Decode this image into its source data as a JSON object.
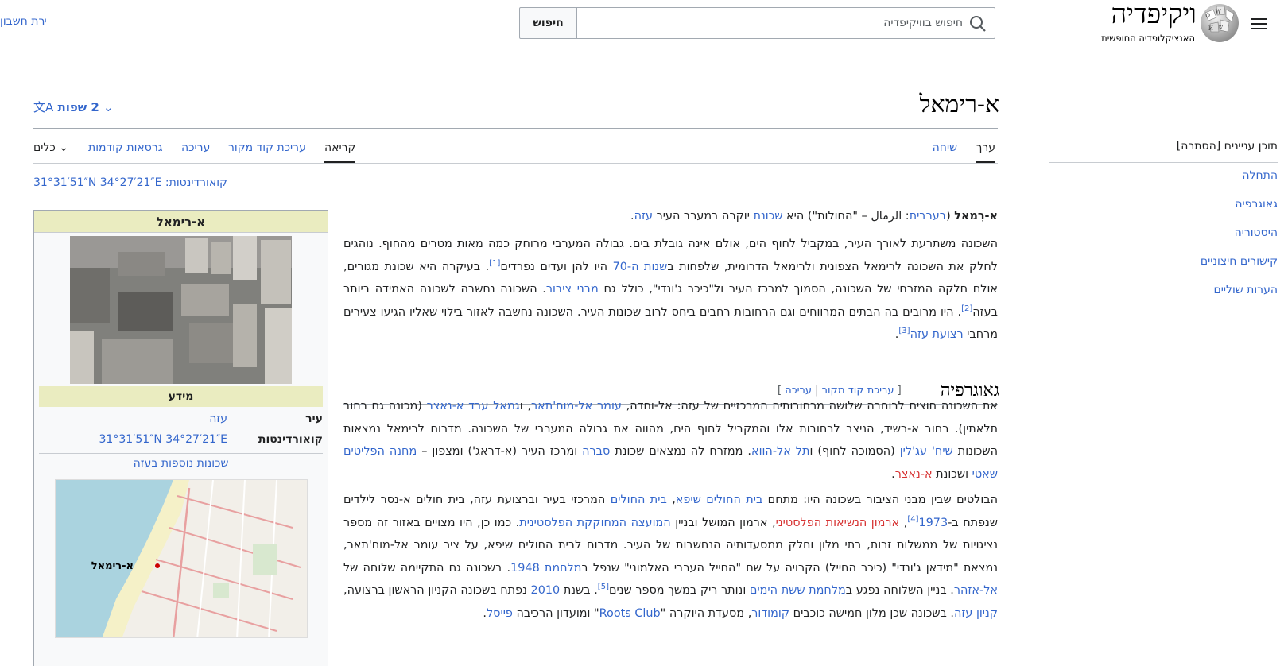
{
  "header": {
    "logo_title": "ויקיפדיה",
    "logo_tagline": "האנציקלופדיה החופשית",
    "search_placeholder": "חיפוש בוויקיפדיה",
    "search_button": "חיפוש",
    "create_account": "יצירת חשבון"
  },
  "toc": {
    "title": "תוכן עניינים",
    "toggle": "[הסתרה]",
    "items": [
      "התחלה",
      "גאוגרפיה",
      "היסטוריה",
      "קישורים חיצוניים",
      "הערות שוליים"
    ]
  },
  "page": {
    "title": "א-רימאל",
    "languages": "2 שפות",
    "coords_line": "קואורדינטות: 31°31′51″N 34°27′21″E"
  },
  "tabs": {
    "article": "ערך",
    "talk": "שיחה",
    "read": "קריאה",
    "edit_source": "עריכת קוד מקור",
    "edit": "עריכה",
    "history": "גרסאות קודמות",
    "tools": "כלים"
  },
  "infobox": {
    "title": "א-רימאל",
    "info_header": "מידע",
    "city_label": "עיר",
    "city_value": "עזה",
    "coords_label": "קואורדינטות",
    "coords_value": "31°31′51″N 34°27′21″E",
    "more_link": "שכונות נוספות בעזה",
    "map_label": "א-רימאל"
  },
  "section": {
    "geo_heading": "גאוגרפיה",
    "edit_source": "עריכת קוד מקור",
    "edit": "עריכה"
  },
  "refs": [
    "[1]",
    "[2]",
    "[3]",
    "[4]",
    "[5]"
  ],
  "text": {
    "p1_a": "א-רִמאל",
    "p1_b": " (",
    "p1_arabic_link": "בערבית",
    "p1_c": ": الرمال – \"החולות\") היא ",
    "p1_link": "שכונת",
    "p1_d": " יוקרה במערב העיר ",
    "p1_gaza": "עזה",
    "p1_e": ".",
    "p2_a": "השכונה משתרעת לאורך העיר, במקביל לחוף הים, אולם אינה גובלת בים. גבולה המערבי מרוחק כמה מאות מטרים מהחוף. נוהגים לחלק את השכונה לרימאל הצפונית ולרימאל הדרומית, שלפחות ב",
    "p2_link": "שנות ה-70",
    "p2_b": " היו להן ועדים נפרדים",
    "p2_c": ". בעיקרה היא שכונת מגורים, אולם חלקה המזרחי של השכונה, הסמוך למרכז העיר ול\"כיכר ג'ונדי\", כולל גם ",
    "p2_link2": "מבני ציבור",
    "p2_d": ". השכונה נחשבה לשכונה האמידה ביותר בעזה",
    "p2_e": ". היו מרובים בה הבתים המרווחים וגם הרחובות רחבים ביחס לרוב שכונות העיר. השכונה נחשבה לאזור בילוי שאליו הגיעו צעירים מרחבי ",
    "p2_link3": "רצועת עזה",
    "p2_f": ".",
    "p3_a": "את השכונה חוצים לרוחבה שלושה מרחובותיה המרכזיים של עזה: אל-וחדה, ",
    "p3_link1": "עומר אל-מוח'תאר",
    "p3_b": ", ו",
    "p3_link2": "גמאל עבד א-נאצר",
    "p3_c": " (מכונה גם רחוב תלאתין). רחוב א-רשיד, הניצב לרחובות אלו והמקביל לחוף הים, מהווה את גבולה המערבי של השכונה. מדרום לרימאל נמצאות השכונות ",
    "p3_link3": "שיח' עג'לין",
    "p3_d": " (הסמוכה לחוף) ו",
    "p3_link4": "תל אל-הווא",
    "p3_e": ". ממזרח לה נמצאים שכונת ",
    "p3_link5": "סברה",
    "p3_f": " ומרכז העיר (א-דראג') ומצפון – ",
    "p3_link6": "מחנה הפליטים שאטי",
    "p3_g": " ושכונת ",
    "p3_link7": "א-נאצר",
    "p3_h": ".",
    "p4_a": "הבולטים שבין מבני הציבור בשכונה היו: מתחם ",
    "p4_link1": "בית החולים שיפא",
    "p4_b": ", ",
    "p4_link2": "בית החולים",
    "p4_c": " המרכזי בעיר וברצועת עזה, בית חולים א-נסר לילדים שנפתח ב-",
    "p4_link3": "1973",
    "p4_d": ", ",
    "p4_link4": "ארמון הנשיאות הפלסטיני",
    "p4_e": ", ארמון המושל ובניין ",
    "p4_link5": "המועצה המחוקקת הפלסטינית",
    "p4_f": ". כמו כן, היו מצויים באזור זה מספר נציגויות של ממשלות זרות, בתי מלון וחלק ממסעדותיה הנחשבות של העיר. מדרום לבית החולים שיפא, על ציר עומר אל-מוח'תאר, נמצאת \"מידאן ג'ונדי\" (כיכר החייל) הקרויה על שם \"החייל הערבי האלמוני\" שנפל ב",
    "p4_link6": "מלחמת 1948",
    "p4_g": ". בשכונה גם התקיימה שלוחה של ",
    "p4_link7": "אל-אזהר",
    "p4_h": ". בניין השלוחה נפגע ב",
    "p4_link8": "מלחמת ששת הימים",
    "p4_i": " ונותר ריק במשך מספר שנים",
    "p4_j": ". בשנת ",
    "p4_link9": "2010",
    "p4_k": " נפתח בשכונה הקניון הראשון ברצועה, ",
    "p4_link10": "קניון עזה",
    "p4_l": ". בשכונה שכן מלון חמישה כוכבים ",
    "p4_link11": "קומודור",
    "p4_m": ", מסעדת היוקרה \"",
    "p4_link12": "Roots Club",
    "p4_n": "\" ומועדון הרכיבה ",
    "p4_link13": "פייסל",
    "p4_o": "."
  }
}
